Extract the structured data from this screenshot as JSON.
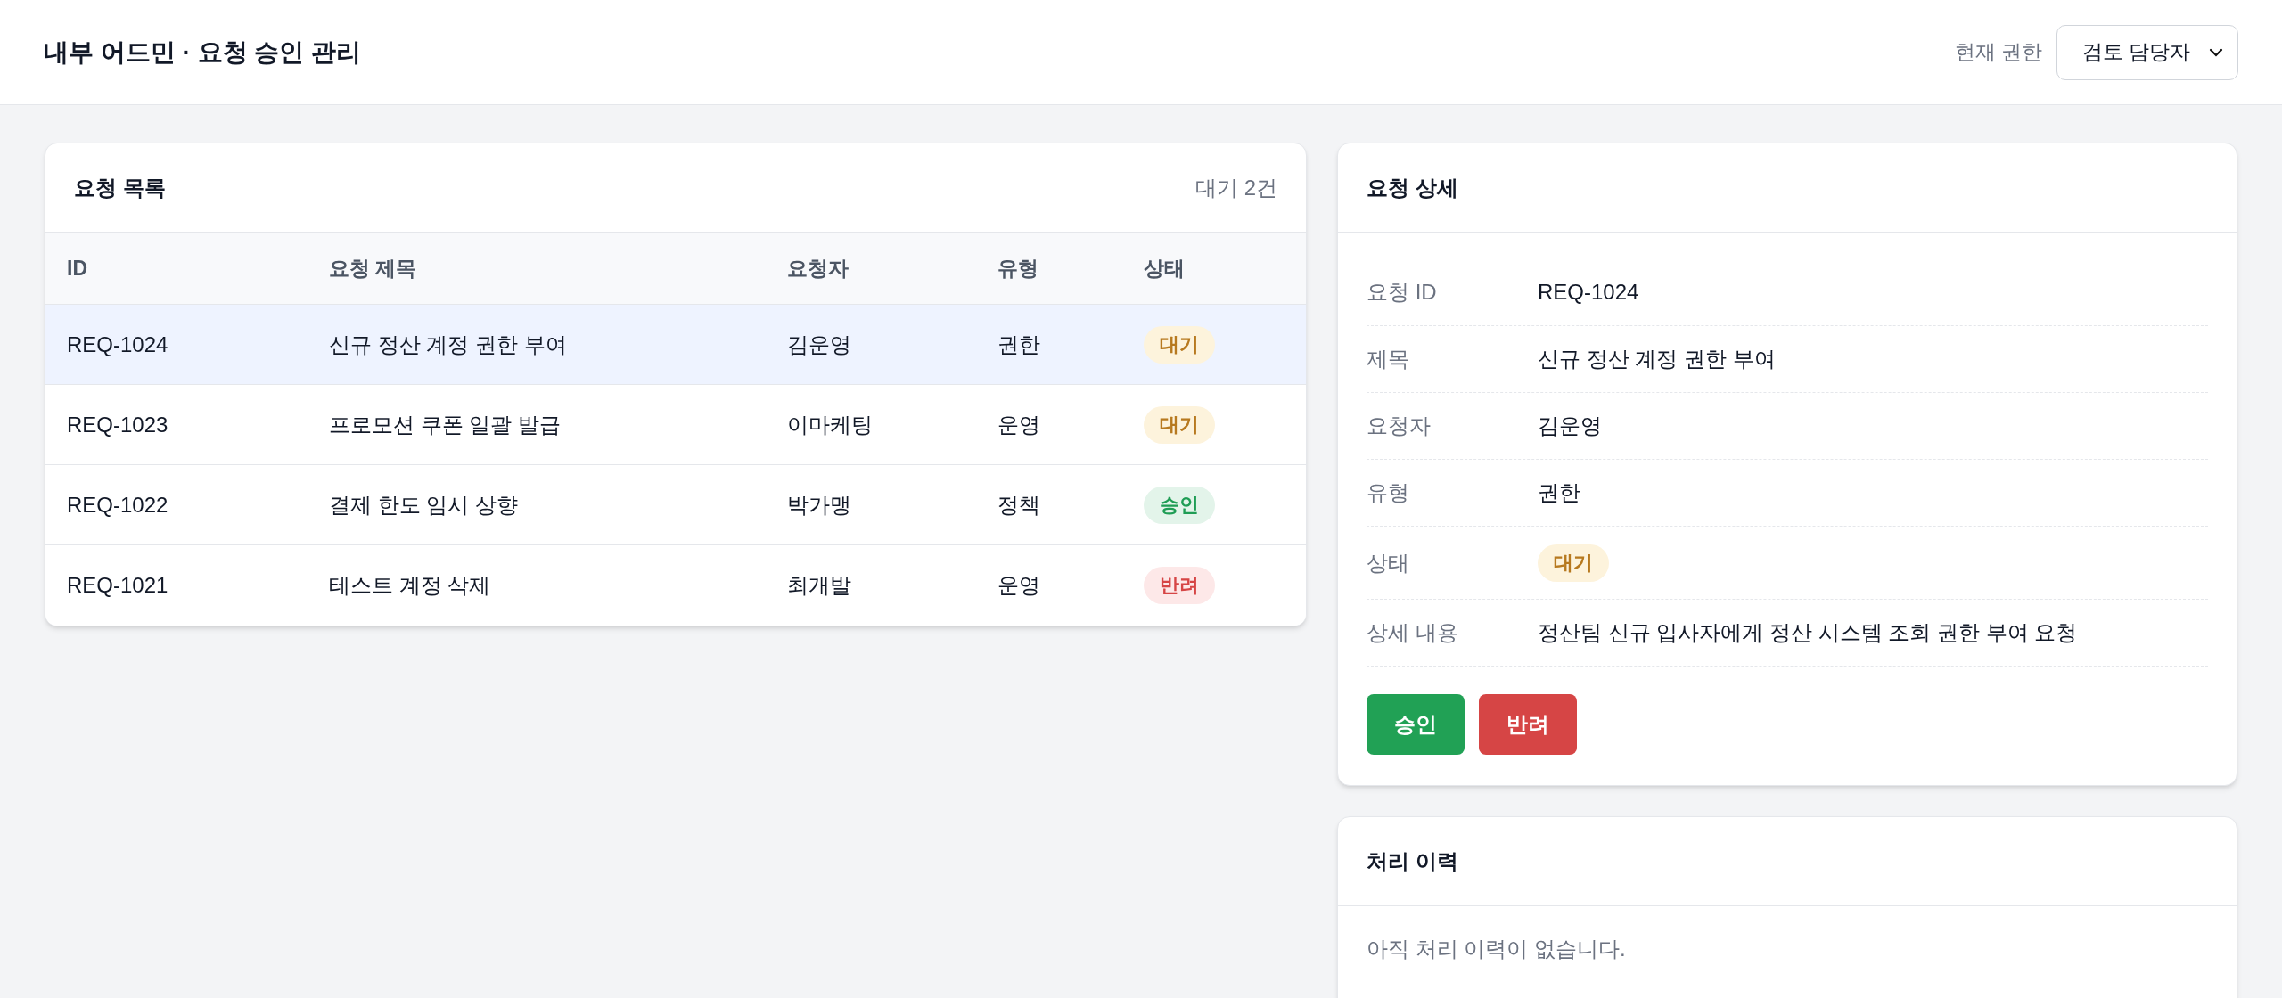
{
  "header": {
    "title": "내부 어드민 · 요청 승인 관리",
    "role_label": "현재 권한",
    "role_select": {
      "value": "검토 담당자"
    }
  },
  "request_list": {
    "title": "요청 목록",
    "count": "대기 2건",
    "columns": [
      "ID",
      "요청 제목",
      "요청자",
      "유형",
      "상태"
    ],
    "rows": [
      {
        "id": "REQ-1024",
        "title": "신규 정산 계정 권한 부여",
        "requester": "김운영",
        "type": "권한",
        "status": {
          "label": "대기",
          "kind": "pending"
        },
        "selected": true
      },
      {
        "id": "REQ-1023",
        "title": "프로모션 쿠폰 일괄 발급",
        "requester": "이마케팅",
        "type": "운영",
        "status": {
          "label": "대기",
          "kind": "pending"
        },
        "selected": false
      },
      {
        "id": "REQ-1022",
        "title": "결제 한도 임시 상향",
        "requester": "박가맹",
        "type": "정책",
        "status": {
          "label": "승인",
          "kind": "approved"
        },
        "selected": false
      },
      {
        "id": "REQ-1021",
        "title": "테스트 계정 삭제",
        "requester": "최개발",
        "type": "운영",
        "status": {
          "label": "반려",
          "kind": "rejected"
        },
        "selected": false
      }
    ]
  },
  "request_detail": {
    "title": "요청 상세",
    "fields": [
      {
        "label": "요청 ID",
        "value": "REQ-1024",
        "kind": "text"
      },
      {
        "label": "제목",
        "value": "신규 정산 계정 권한 부여",
        "kind": "text"
      },
      {
        "label": "요청자",
        "value": "김운영",
        "kind": "text"
      },
      {
        "label": "유형",
        "value": "권한",
        "kind": "text"
      },
      {
        "label": "상태",
        "kind": "status",
        "status": {
          "label": "대기",
          "kind": "pending"
        }
      },
      {
        "label": "상세 내용",
        "value": "정산팀 신규 입사자에게 정산 시스템 조회 권한 부여 요청",
        "kind": "text"
      }
    ],
    "buttons": [
      {
        "label": "승인",
        "kind": "approve"
      },
      {
        "label": "반려",
        "kind": "reject"
      }
    ]
  },
  "history": {
    "title": "처리 이력",
    "empty_text": "아직 처리 이력이 없습니다."
  }
}
